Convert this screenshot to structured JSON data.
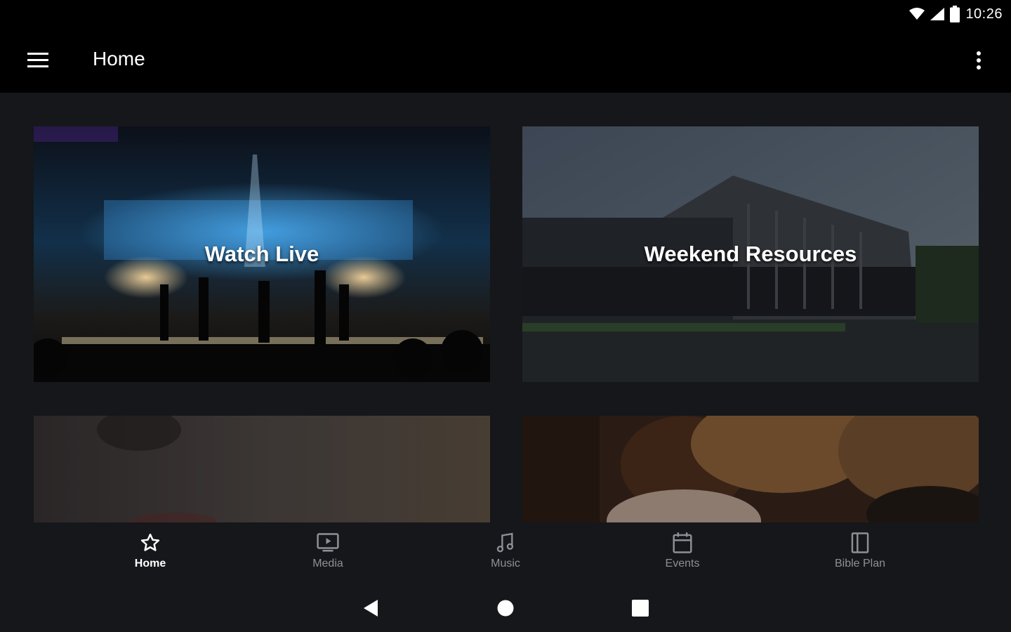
{
  "status_bar": {
    "time": "10:26",
    "icons": [
      "wifi-icon",
      "cellular-signal-icon",
      "battery-icon"
    ]
  },
  "app_bar": {
    "title": "Home",
    "menu_icon": "hamburger-menu-icon",
    "overflow_icon": "more-vertical-icon"
  },
  "tiles": [
    {
      "label": "Watch Live",
      "image": "concert stage with worship band and audience"
    },
    {
      "label": "Weekend Resources",
      "image": "church building exterior at dusk"
    },
    {
      "label": "",
      "image": "blurred warm interior"
    },
    {
      "label": "",
      "image": "people embracing"
    }
  ],
  "bottom_nav": {
    "items": [
      {
        "label": "Home",
        "icon": "star-icon",
        "active": true
      },
      {
        "label": "Media",
        "icon": "tv-play-icon",
        "active": false
      },
      {
        "label": "Music",
        "icon": "music-note-icon",
        "active": false
      },
      {
        "label": "Events",
        "icon": "calendar-icon",
        "active": false
      },
      {
        "label": "Bible Plan",
        "icon": "book-icon",
        "active": false
      }
    ]
  },
  "system_nav": {
    "buttons": [
      "back-icon",
      "home-icon",
      "recents-icon"
    ]
  },
  "colors": {
    "app_bar_bg": "#000000",
    "content_bg": "#15171a",
    "nav_active": "#ffffff",
    "nav_inactive": "#8d9095"
  }
}
